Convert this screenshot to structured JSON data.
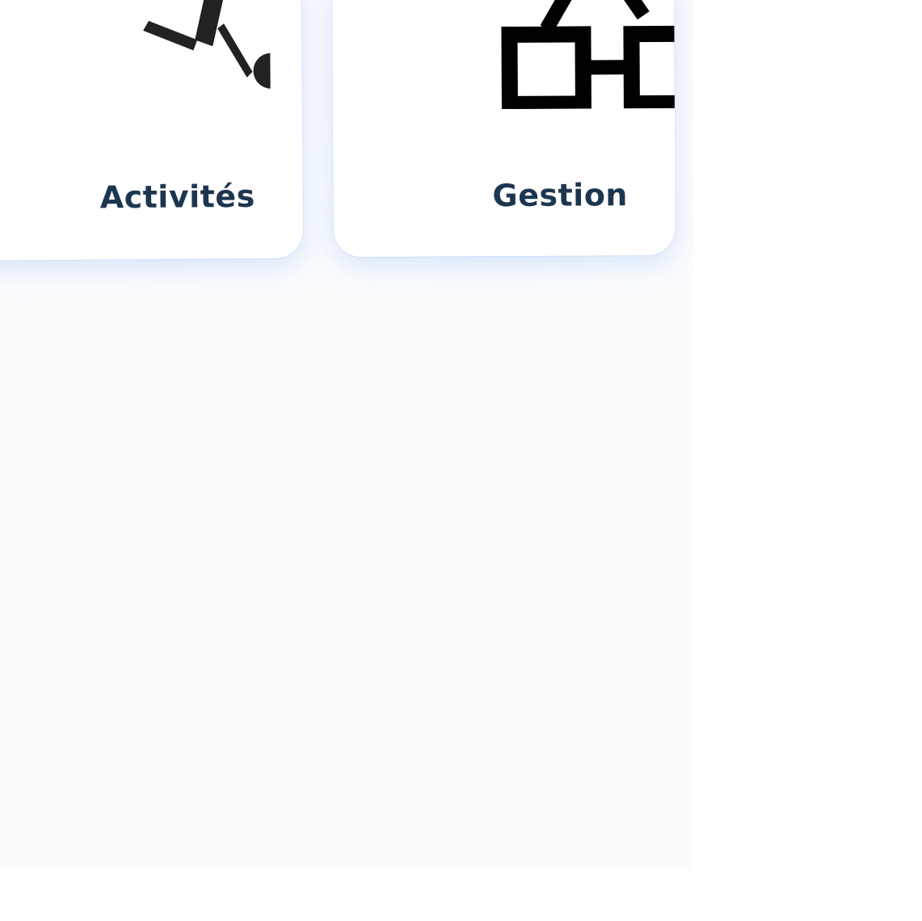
{
  "tiles": [
    {
      "label": "Activités",
      "icon": "running-person-icon"
    },
    {
      "label": "Gestion",
      "icon": "organization-structure-icon"
    }
  ],
  "colors": {
    "label_text": "#1d3650",
    "card_background": "#ffffff",
    "page_background": "#fbfcfe",
    "card_shadow": "#8ab4ee",
    "icon_stroke": "#000000"
  }
}
